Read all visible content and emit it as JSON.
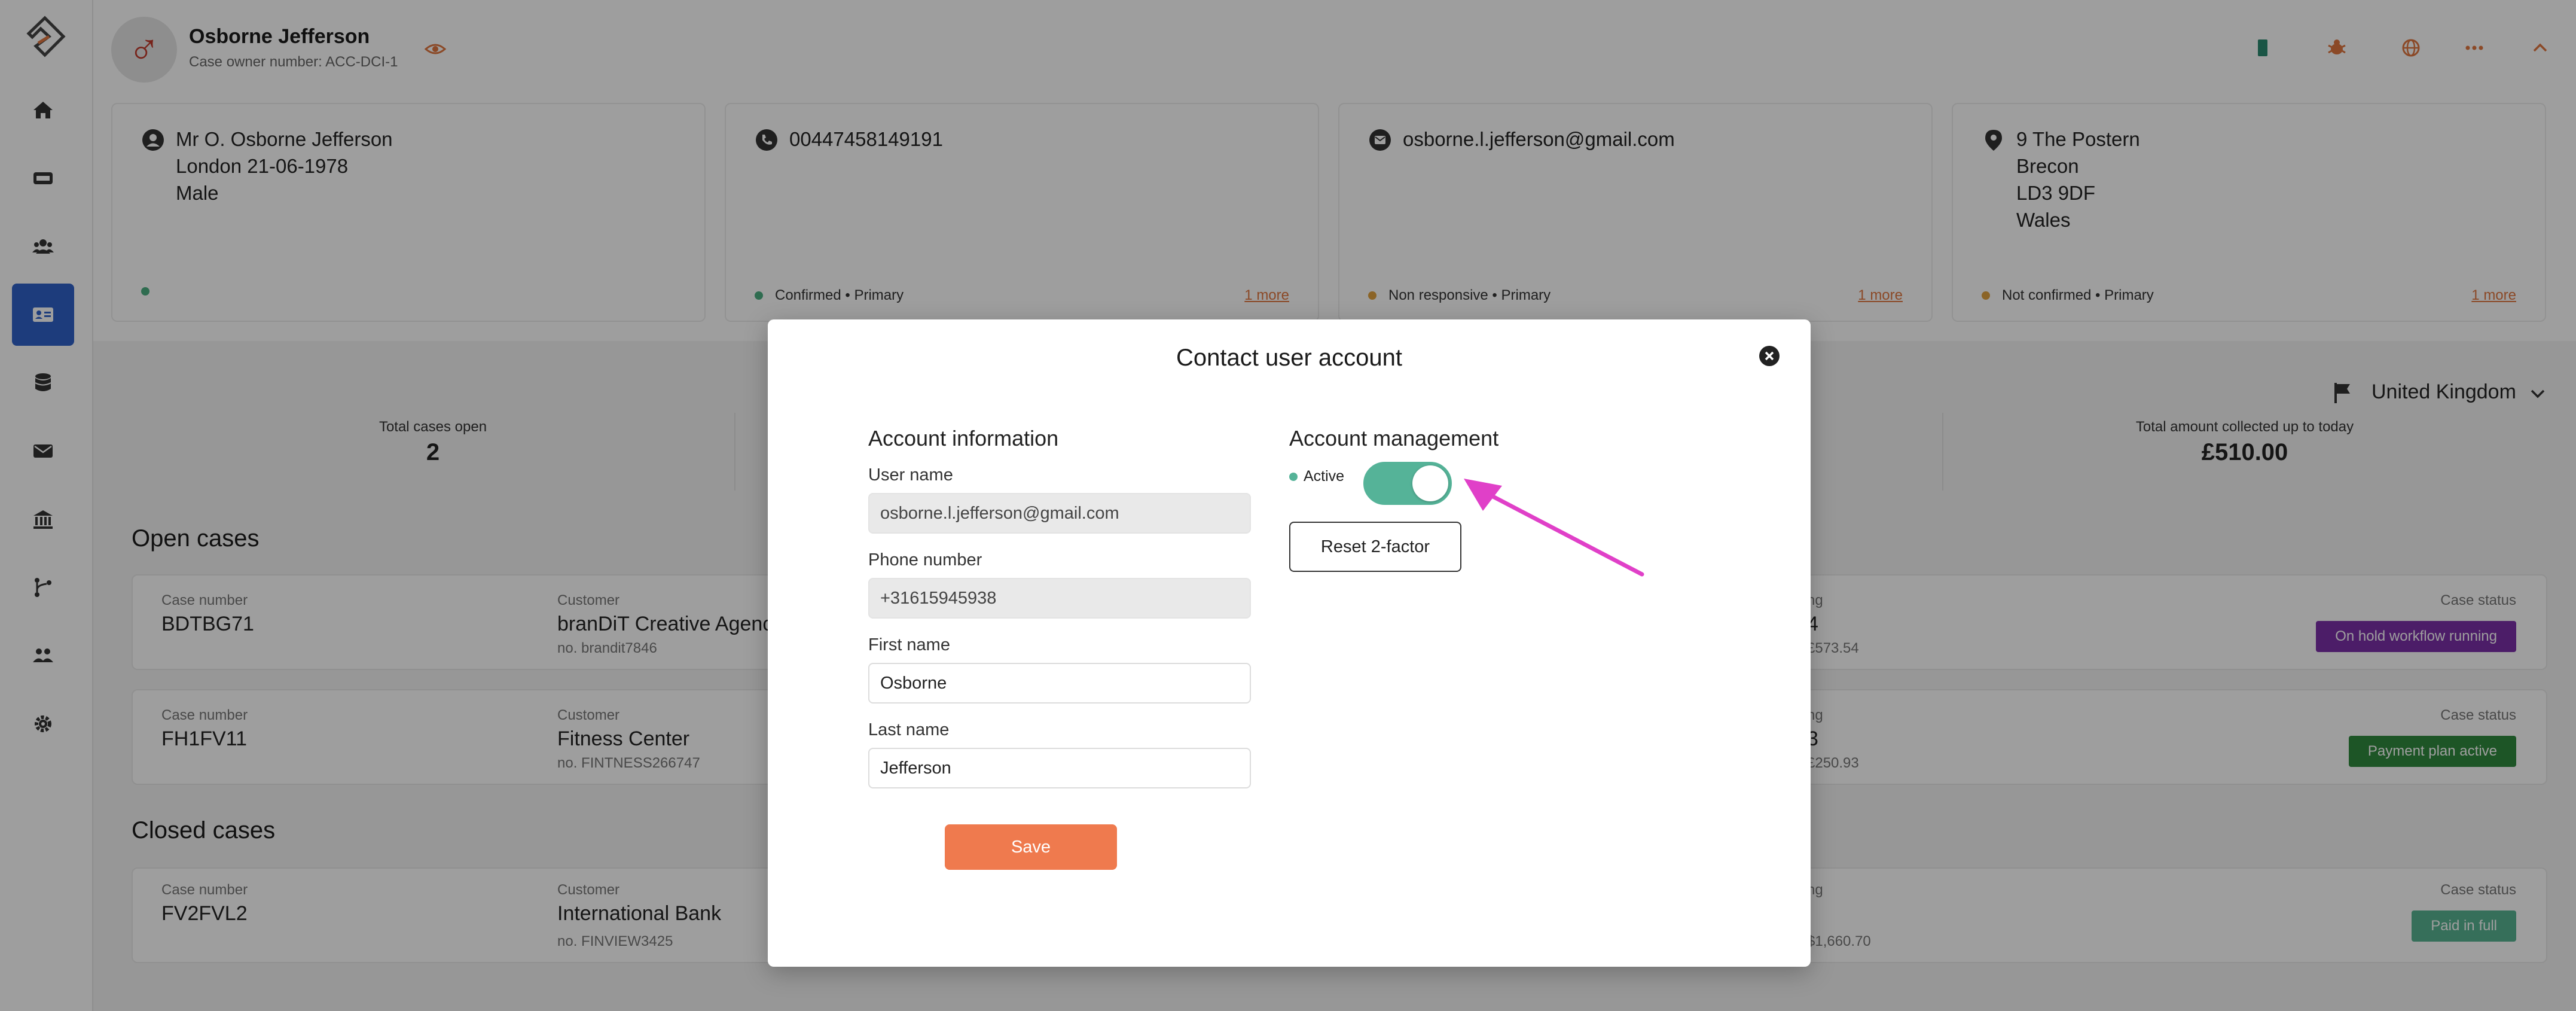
{
  "colors": {
    "accent": "#ef7a4e",
    "sidebar_active": "#2f62c9",
    "toggle_on": "#55b398",
    "status_green": "#4caf82",
    "status_orange": "#e0a23f",
    "badge_hold": "#7b2fa8",
    "badge_plan": "#2f8a3e",
    "badge_paid": "#58b391",
    "arrow": "#e040c8"
  },
  "sidebar": {
    "items": [
      {
        "name": "home-icon"
      },
      {
        "name": "ticket-icon"
      },
      {
        "name": "users-icon"
      },
      {
        "name": "contact-card-icon",
        "active": true
      },
      {
        "name": "database-icon"
      },
      {
        "name": "mail-icon"
      },
      {
        "name": "bank-icon"
      },
      {
        "name": "workflow-icon"
      },
      {
        "name": "team-icon"
      },
      {
        "name": "gear-icon"
      }
    ]
  },
  "header": {
    "name": "Osborne Jefferson",
    "case_owner": "Case owner number: ACC-DCI-1"
  },
  "info_cards": {
    "person": {
      "lines": [
        "Mr O. Osborne Jefferson",
        "London 21-06-1978",
        "Male"
      ]
    },
    "phone": {
      "value": "00447458149191",
      "status": "Confirmed • Primary",
      "more": "1 more"
    },
    "email": {
      "value": "osborne.l.jefferson@gmail.com",
      "status": "Non responsive • Primary",
      "more": "1 more"
    },
    "address": {
      "lines": [
        "9 The Postern",
        "Brecon",
        "LD3 9DF",
        "Wales"
      ],
      "status": "Not confirmed • Primary",
      "more": "1 more"
    }
  },
  "stats": {
    "country": "United Kingdom",
    "total_open_label": "Total cases open",
    "total_open_value": "2",
    "collected_label": "Total amount collected up to today",
    "collected_value": "£510.00"
  },
  "open_cases": {
    "title": "Open cases",
    "rows": [
      {
        "case_label": "Case number",
        "case_number": "BDTBG71",
        "customer_label": "Customer",
        "customer": "branDiT Creative Agency",
        "customer_no": "no.   brandit7846",
        "remaining_label": "ng",
        "remaining_value": "4",
        "remaining_sub": "£573.54",
        "status_label": "Case status",
        "status": "On hold workflow running"
      },
      {
        "case_label": "Case number",
        "case_number": "FH1FV11",
        "customer_label": "Customer",
        "customer": "Fitness Center",
        "customer_no": "no.   FINTNESS266747",
        "remaining_label": "ng",
        "remaining_value": "3",
        "remaining_sub": "£250.93",
        "status_label": "Case status",
        "status": "Payment plan active"
      }
    ]
  },
  "closed_cases": {
    "title": "Closed cases",
    "rows": [
      {
        "case_label": "Case number",
        "case_number": "FV2FVL2",
        "customer_label": "Customer",
        "customer": "International Bank",
        "customer_no": "no.   FINVIEW3425",
        "remaining_label": "ng",
        "remaining_sub": "$1,660.70",
        "status_label": "Case status",
        "status": "Paid in full"
      }
    ]
  },
  "modal": {
    "title": "Contact user account",
    "account_info_title": "Account information",
    "account_mgmt_title": "Account management",
    "username_label": "User name",
    "username_value": "osborne.l.jefferson@gmail.com",
    "phone_label": "Phone number",
    "phone_value": "+31615945938",
    "first_name_label": "First name",
    "first_name_value": "Osborne",
    "last_name_label": "Last name",
    "last_name_value": "Jefferson",
    "save_label": "Save",
    "active_label": "Active",
    "active_on": true,
    "reset_label": "Reset 2-factor"
  }
}
